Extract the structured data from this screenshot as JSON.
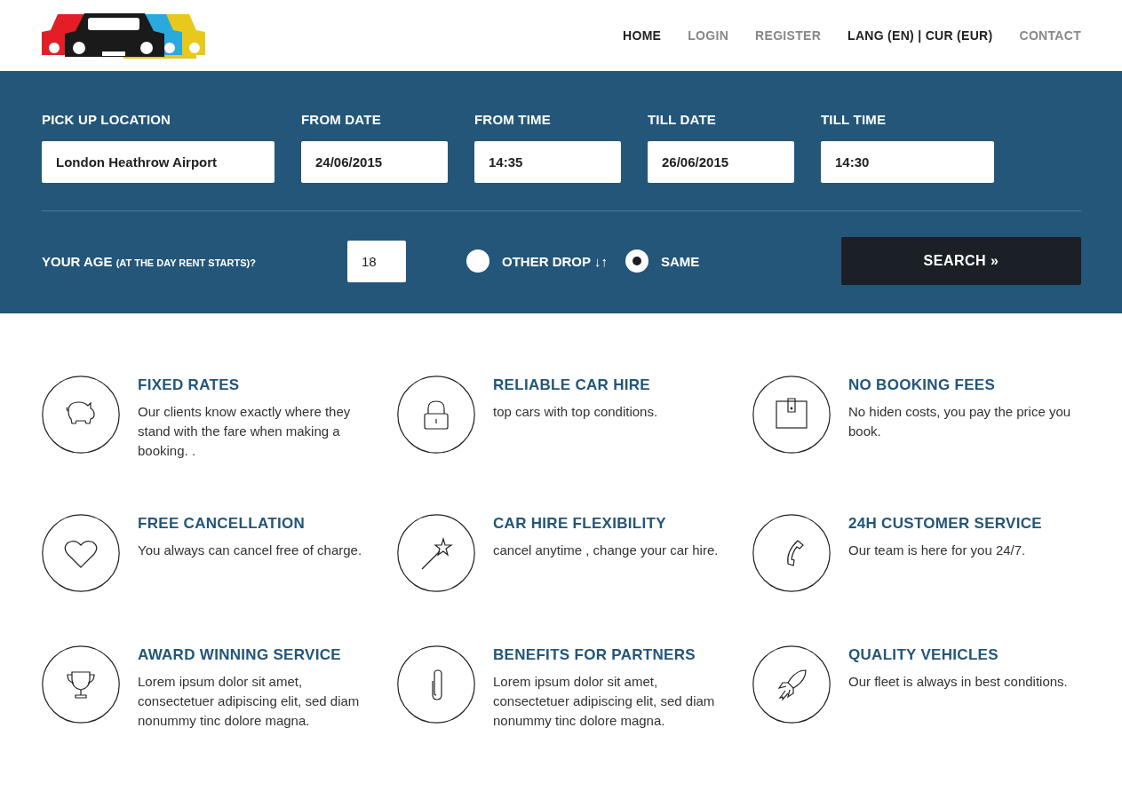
{
  "nav": [
    {
      "label": "HOME",
      "active": true
    },
    {
      "label": "LOGIN",
      "active": false
    },
    {
      "label": "REGISTER",
      "active": false
    },
    {
      "label": "LANG (EN) | CUR (EUR)",
      "active": true
    },
    {
      "label": "CONTACT",
      "active": false
    }
  ],
  "search": {
    "fields": [
      {
        "label": "PICK UP LOCATION",
        "value": "London Heathrow Airport"
      },
      {
        "label": "FROM DATE",
        "value": "24/06/2015"
      },
      {
        "label": "FROM TIME",
        "value": "14:35"
      },
      {
        "label": "TILL DATE",
        "value": "26/06/2015"
      },
      {
        "label": "TILL TIME",
        "value": "14:30"
      }
    ],
    "age_label": "YOUR AGE",
    "age_note": "(AT THE DAY RENT STARTS)?",
    "age_value": "18",
    "drop_options": [
      {
        "label": "OTHER DROP ↓↑",
        "selected": false
      },
      {
        "label": "SAME",
        "selected": true
      }
    ],
    "button": "SEARCH »"
  },
  "features": [
    {
      "title": "FIXED RATES",
      "text": "Our clients know exactly where they stand with the fare when making a booking. ."
    },
    {
      "title": "RELIABLE CAR HIRE",
      "text": "top cars with top conditions."
    },
    {
      "title": "NO BOOKING FEES",
      "text": "No hiden costs, you pay the price you book."
    },
    {
      "title": "FREE CANCELLATION",
      "text": "You always can cancel free of charge."
    },
    {
      "title": "CAR HIRE FLEXIBILITY",
      "text": "cancel anytime , change your car hire."
    },
    {
      "title": "24H CUSTOMER SERVICE",
      "text": "Our team is here for you 24/7."
    },
    {
      "title": "AWARD WINNING SERVICE",
      "text": "Lorem ipsum dolor sit amet, consectetuer adipiscing elit, sed diam nonummy tinc dolore magna."
    },
    {
      "title": "BENEFITS FOR PARTNERS",
      "text": "Lorem ipsum dolor sit amet, consectetuer adipiscing elit, sed diam nonummy tinc dolore magna."
    },
    {
      "title": "QUALITY VEHICLES",
      "text": "Our fleet is always in best conditions."
    }
  ]
}
